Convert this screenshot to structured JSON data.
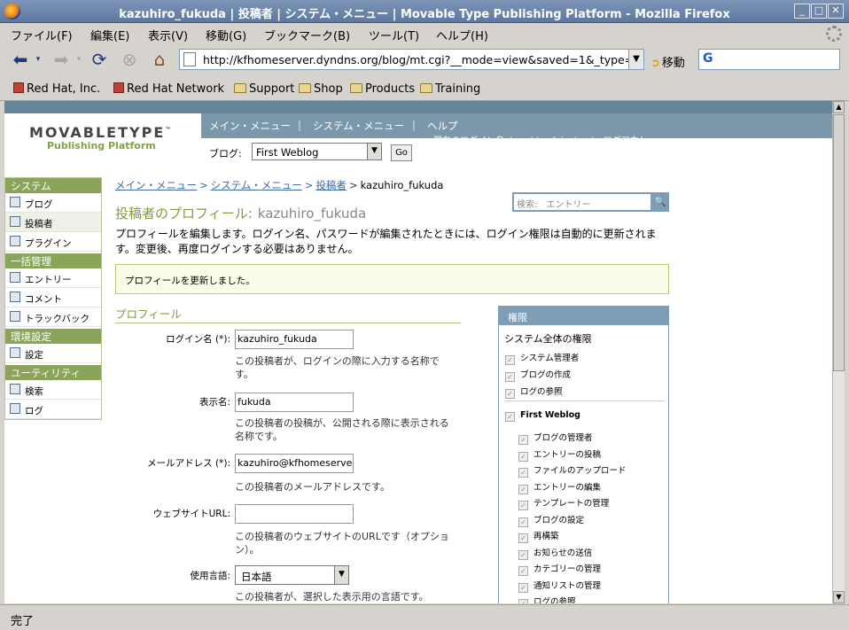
{
  "window": {
    "title": "kazuhiro_fukuda | 投稿者 | システム・メニュー | Movable Type Publishing Platform - Mozilla Firefox"
  },
  "menubar": {
    "items": [
      "ファイル(F)",
      "編集(E)",
      "表示(V)",
      "移動(G)",
      "ブックマーク(B)",
      "ツール(T)",
      "ヘルプ(H)"
    ]
  },
  "navbar": {
    "url": "http://kfhomeserver.dyndns.org/blog/mt.cgi?__mode=view&saved=1&_type=autho",
    "go_label": "移動"
  },
  "bookmarks": [
    "Red Hat, Inc.",
    "Red Hat Network",
    "Support",
    "Shop",
    "Products",
    "Training"
  ],
  "status": "完了",
  "mt": {
    "logo_line1": "MOVABLETYPE",
    "logo_tm": "™",
    "logo_line2": "Publishing Platform",
    "nav": [
      "メイン・メニュー",
      "システム・メニュー",
      "ヘルプ"
    ],
    "nav_sep": "|",
    "userline": "現在のログイン名: kazuhiro_fukuda　|　ログアウト",
    "blog_label": "ブログ:",
    "blog_selected": "First Weblog",
    "go": "Go"
  },
  "sidebar": {
    "sections": [
      {
        "title": "システム",
        "items": [
          "ブログ",
          "投稿者",
          "プラグイン"
        ]
      },
      {
        "title": "一括管理",
        "items": [
          "エントリー",
          "コメント",
          "トラックバック"
        ]
      },
      {
        "title": "環境設定",
        "items": [
          "設定"
        ]
      },
      {
        "title": "ユーティリティ",
        "items": [
          "検索",
          "ログ"
        ]
      }
    ]
  },
  "breadcrumb": {
    "links": [
      "メイン・メニュー",
      "システム・メニュー",
      "投稿者"
    ],
    "separator": ">",
    "current": "kazuhiro_fukuda"
  },
  "search": {
    "placeholder": "検索:　エントリー"
  },
  "page": {
    "title": "投稿者のプロフィール:",
    "username": "kazuhiro_fukuda",
    "intro": "プロフィールを編集します。ログイン名、パスワードが編集されたときには、ログイン権限は自動的に更新されます。変更後、再度ログインする必要はありません。",
    "message": "プロフィールを更新しました。",
    "section": "プロフィール"
  },
  "form": {
    "login_label": "ログイン名 (*):",
    "login_value": "kazuhiro_fukuda",
    "login_hint": "この投稿者が、ログインの際に入力する名称です。",
    "display_label": "表示名:",
    "display_value": "fukuda",
    "display_hint": "この投稿者の投稿が、公開される際に表示される名称です。",
    "email_label": "メールアドレス (*):",
    "email_value": "kazuhiro@kfhomeserver.d",
    "email_hint": "この投稿者のメールアドレスです。",
    "url_label": "ウェブサイトURL:",
    "url_value": "",
    "url_hint": "この投稿者のウェブサイトのURLです（オプション）。",
    "lang_label": "使用言語:",
    "lang_value": "日本語",
    "lang_hint": "この投稿者が、選択した表示用の言語です。"
  },
  "permissions": {
    "title": "権限",
    "system_title": "システム全体の権限",
    "system": [
      "システム管理者",
      "ブログの作成",
      "ログの参照"
    ],
    "blog_name": "First Weblog",
    "blog": [
      "ブログの管理者",
      "エントリーの投稿",
      "ファイルのアップロード",
      "エントリーの編集",
      "テンプレートの管理",
      "ブログの設定",
      "再構築",
      "お知らせの送信",
      "カテゴリーの管理",
      "通知リストの管理",
      "ログの参照"
    ],
    "check": "✓"
  }
}
